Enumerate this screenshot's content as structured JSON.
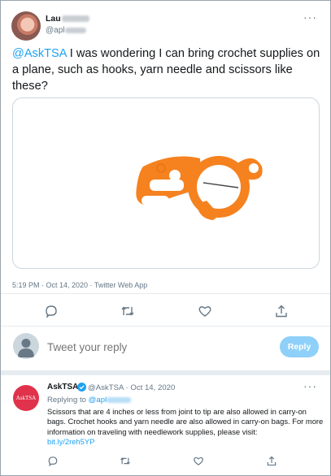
{
  "tweet": {
    "author_name": "Lau",
    "author_handle": "@apl",
    "more_label": "···",
    "mention": "@AskTSA",
    "text": " I was wondering I can bring crochet supplies on a plane, such as hooks, yarn needle and scissors like these?",
    "timestamp": "5:19 PM · Oct 14, 2020 · Twitter Web App",
    "media": {
      "description_icon": "orange-folding-scissors",
      "accent_color": "#f5821f"
    }
  },
  "actions": [
    "reply-icon",
    "retweet-icon",
    "like-icon",
    "share-icon"
  ],
  "composer": {
    "placeholder": "Tweet your reply",
    "button_label": "Reply"
  },
  "reply": {
    "avatar_text": "AskTSA",
    "author_name": "AskTSA",
    "handle_date": "@AskTSA · Oct 14, 2020",
    "more_label": "···",
    "replying_prefix": "Replying to ",
    "replying_handle": "@apl",
    "text": "Scissors that are 4 inches or less from joint to tip are also allowed in carry-on bags. Crochet hooks and yarn needle are also allowed in carry-on bags. For more information on traveling with needlework supplies, please visit: ",
    "link": "bit.ly/2reh5YP"
  },
  "colors": {
    "accent": "#1da1f2",
    "secondary_text": "#657786",
    "reply_button_disabled": "#8ed0f9",
    "tsa_red": "#e0324b"
  }
}
